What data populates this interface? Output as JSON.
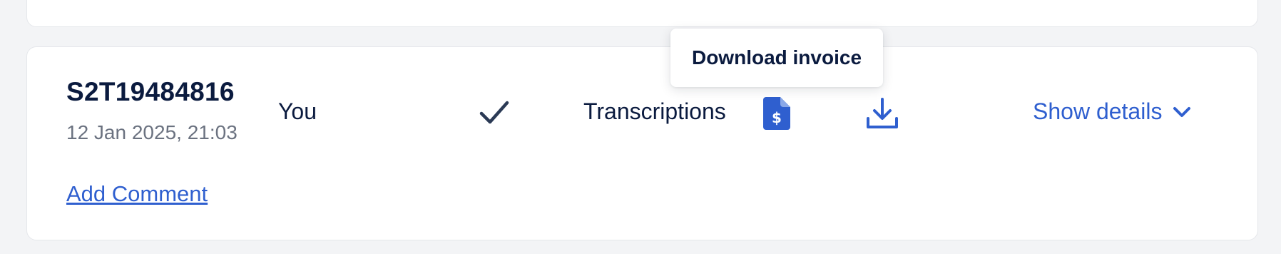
{
  "order": {
    "id": "S2T19484816",
    "date": "12 Jan 2025, 21:03",
    "user": "You",
    "service": "Transcriptions",
    "show_details_label": "Show details",
    "add_comment_label": "Add Comment"
  },
  "tooltip": {
    "text": "Download invoice"
  },
  "icons": {
    "status": "check-icon",
    "invoice": "invoice-document-dollar-icon",
    "download": "download-icon",
    "expand": "chevron-down-icon"
  },
  "colors": {
    "primary_text": "#0b1b3f",
    "muted_text": "#6b7280",
    "accent": "#2f5fcf",
    "background": "#f3f4f6",
    "card": "#ffffff"
  }
}
